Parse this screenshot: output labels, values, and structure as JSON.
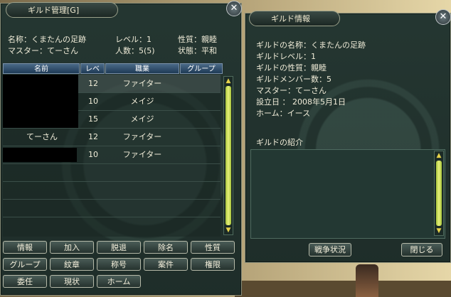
{
  "guild_window": {
    "title": "ギルド管理[G]",
    "name_line": "名称：くまたんの足跡",
    "master_line": "マスター：てーさん",
    "level_line": "レベル：1",
    "members_line": "人数：5(5)",
    "nature_line": "性質：親睦",
    "status_line": "状態：平和",
    "columns": [
      "名前",
      "レベ",
      "職業",
      "グループ"
    ],
    "rows": [
      {
        "name": "",
        "level": "12",
        "job": "ファイター",
        "group": ""
      },
      {
        "name": "",
        "level": "10",
        "job": "メイジ",
        "group": ""
      },
      {
        "name": "",
        "level": "15",
        "job": "メイジ",
        "group": ""
      },
      {
        "name": "てーさん",
        "level": "12",
        "job": "ファイター",
        "group": ""
      },
      {
        "name": "",
        "level": "10",
        "job": "ファイター",
        "group": ""
      }
    ],
    "buttons_row1": [
      "情報",
      "加入",
      "脱退",
      "除名",
      "性質"
    ],
    "buttons_row2": [
      "グループ",
      "紋章",
      "称号",
      "案件",
      "権限"
    ],
    "buttons_row3": [
      "委任",
      "現状",
      "ホーム"
    ]
  },
  "info_window": {
    "title": "ギルド情報",
    "lines": [
      "ギルドの名称：くまたんの足跡",
      "ギルドレベル：1",
      "ギルドの性質：親睦",
      "ギルドメンバー数：5",
      "マスター：てーさん",
      "設立日 ： 2008年5月1日",
      "ホーム：イース"
    ],
    "intro_label": "ギルドの紹介",
    "war_button": "戦争状況",
    "close_button": "閉じる"
  },
  "close_glyph": "✕",
  "scroll_up": "▲",
  "scroll_down": "▼"
}
